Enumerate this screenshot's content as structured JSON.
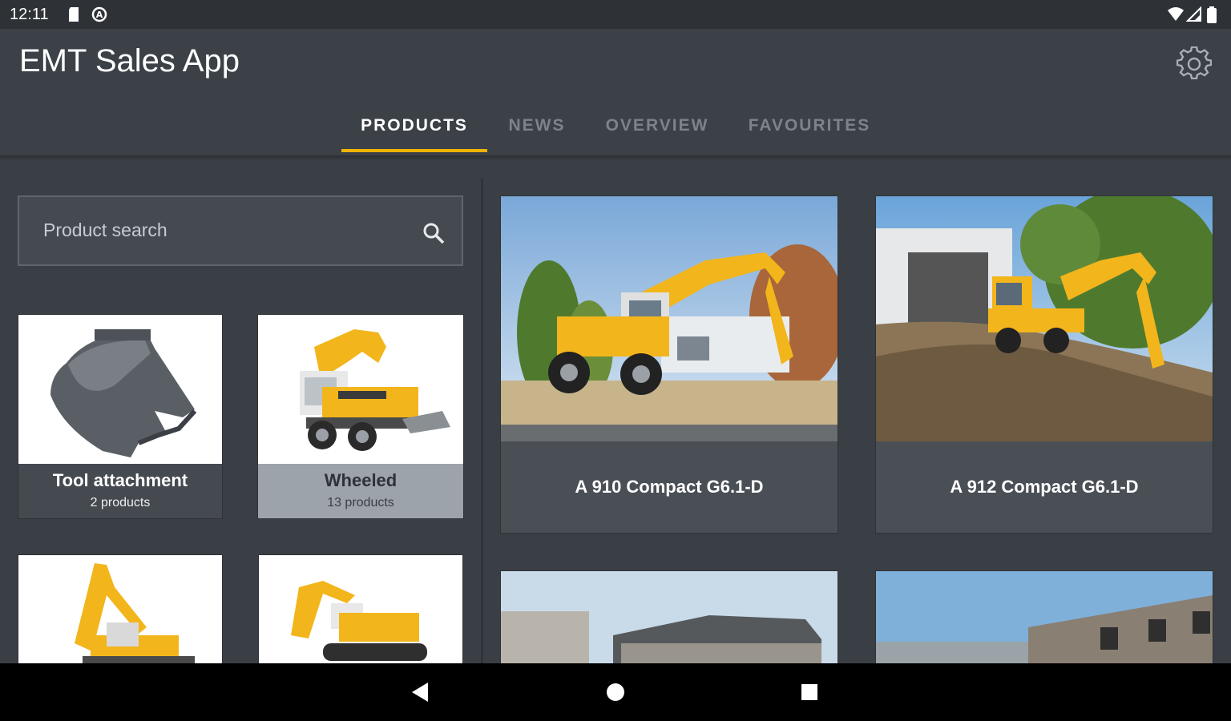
{
  "status_bar": {
    "time": "12:11"
  },
  "app": {
    "title": "EMT Sales App"
  },
  "tabs": [
    {
      "label": "PRODUCTS",
      "active": true
    },
    {
      "label": "NEWS",
      "active": false
    },
    {
      "label": "OVERVIEW",
      "active": false
    },
    {
      "label": "FAVOURITES",
      "active": false
    }
  ],
  "search": {
    "placeholder": "Product search"
  },
  "categories": [
    {
      "name": "Tool attachment",
      "count": "2 products",
      "selected": false
    },
    {
      "name": "Wheeled",
      "count": "13 products",
      "selected": true
    }
  ],
  "products": [
    {
      "name": "A 910 Compact G6.1-D"
    },
    {
      "name": "A 912 Compact G6.1-D"
    }
  ],
  "colors": {
    "accent": "#f0b400",
    "appbar": "#3c4148",
    "background": "#3a3f45",
    "machine_yellow": "#f2b51b"
  },
  "icons": [
    "sd-card-icon",
    "no-entry-icon",
    "wifi-icon",
    "signal-icon",
    "battery-icon",
    "gear-icon",
    "search-icon",
    "back-icon",
    "home-icon",
    "recents-icon"
  ]
}
